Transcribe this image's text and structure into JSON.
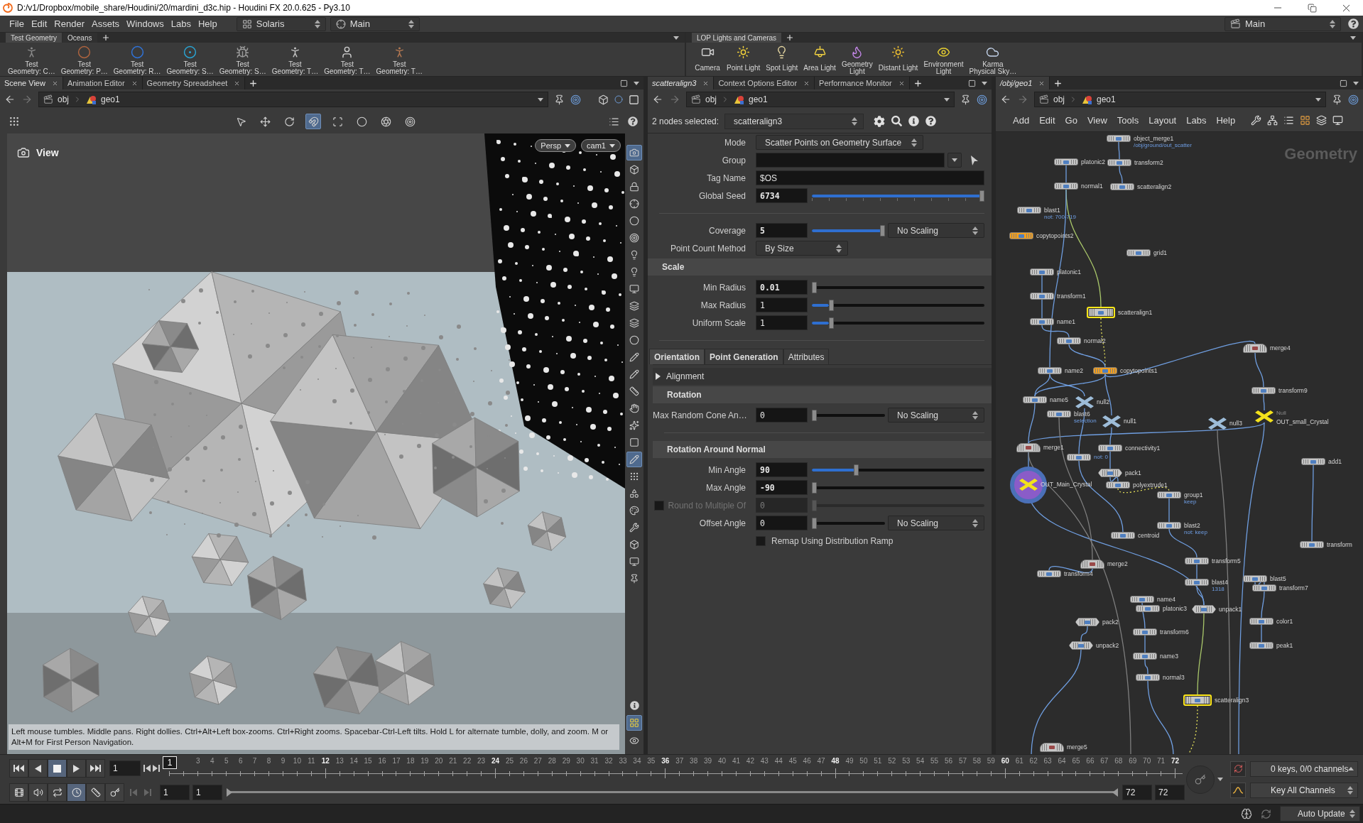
{
  "window": {
    "title": "D:/v1/Dropbox/mobile_share/Houdini/20/mardini_d3c.hip - Houdini FX 20.0.625 - Py3.10"
  },
  "menu_bar": {
    "items": [
      "File",
      "Edit",
      "Render",
      "Assets",
      "Windows",
      "Labs",
      "Help"
    ],
    "desktop": "Solaris",
    "context": "Main",
    "right_context": "Main"
  },
  "shelves": [
    {
      "tabs": [
        {
          "label": "Test Geometry",
          "selected": true
        },
        {
          "label": "Oceans",
          "selected": false
        }
      ],
      "tools": [
        "Test\nGeometry: C…",
        "Test\nGeometry: P…",
        "Test\nGeometry: R…",
        "Test\nGeometry: S…",
        "Test\nGeometry: S…",
        "Test\nGeometry: T…",
        "Test\nGeometry: T…",
        "Test\nGeometry: T…"
      ]
    },
    {
      "tabs": [
        {
          "label": "LOP Lights and Cameras",
          "selected": true
        }
      ],
      "tools": [
        "Camera",
        "Point Light",
        "Spot Light",
        "Area Light",
        "Geometry\nLight",
        "Distant Light",
        "Environment\nLight",
        "Karma\nPhysical Sky…"
      ]
    }
  ],
  "scene_view": {
    "tabs": [
      {
        "label": "Scene View",
        "selected": true
      },
      {
        "label": "Animation Editor",
        "selected": false
      },
      {
        "label": "Geometry Spreadsheet",
        "selected": false
      }
    ],
    "path": [
      "obj",
      "geo1"
    ],
    "top_tools": [
      {
        "on": false
      },
      {
        "on": false
      },
      {
        "on": false
      },
      {
        "on": true
      },
      {
        "on": false
      },
      {
        "on": false
      },
      {
        "on": false
      },
      {
        "on": false
      }
    ],
    "side_tools": [
      {
        "on": true
      },
      {
        "on": false
      },
      {
        "on": false
      },
      {
        "on": false
      },
      {
        "on": false
      },
      {
        "on": false
      },
      {
        "on": false
      },
      {
        "on": false
      },
      {
        "on": false
      },
      {
        "on": false
      },
      {
        "on": false
      },
      {
        "on": false
      },
      {
        "on": false
      },
      {
        "on": false
      },
      {
        "on": false
      },
      {
        "on": false
      },
      {
        "on": false
      },
      {
        "on": false
      },
      {
        "on": true
      },
      {
        "on": false
      },
      {
        "on": false
      },
      {
        "on": false
      },
      {
        "on": false
      },
      {
        "on": false
      },
      {
        "on": false
      },
      {
        "on": false
      },
      {
        "on": false
      },
      {
        "on": true
      },
      {
        "on": false
      }
    ],
    "title": "View",
    "camera_menus": [
      "Persp",
      "cam1"
    ],
    "help_text": "Left mouse tumbles. Middle pans. Right dollies. Ctrl+Alt+Left box-zooms. Ctrl+Right zooms. Spacebar-Ctrl-Left tilts. Hold L for alternate tumble, dolly, and zoom. M or Alt+M for First Person Navigation."
  },
  "parameters": {
    "tabs": [
      {
        "label": "scatteralign3",
        "selected": true
      },
      {
        "label": "Context Options Editor",
        "selected": false
      },
      {
        "label": "Performance Monitor",
        "selected": false
      }
    ],
    "path": [
      "obj",
      "geo1"
    ],
    "selection_label": "2 nodes selected:",
    "node_name": "scatteralign3",
    "rows": [
      {
        "kind": "menu",
        "label": "Mode",
        "value": "Scatter Points on Geometry Surface"
      },
      {
        "kind": "group_field",
        "label": "Group"
      },
      {
        "kind": "string",
        "label": "Tag Name",
        "value": "$OS"
      },
      {
        "kind": "ticked_slider",
        "label": "Global Seed",
        "value": "6734",
        "level": 1,
        "modified": true
      },
      {
        "kind": "separator"
      },
      {
        "kind": "slider",
        "label": "Coverage",
        "value": "5",
        "level": 1,
        "modified": true,
        "scaling": "No Scaling"
      },
      {
        "kind": "menu",
        "label": "Point Count Method",
        "value": "By Size"
      },
      {
        "kind": "heading",
        "label": "Scale"
      },
      {
        "kind": "slider",
        "label": "Min Radius",
        "value": "0.01",
        "level": 0,
        "modified": true
      },
      {
        "kind": "slider",
        "label": "Max Radius",
        "value": "1",
        "level": 0.1,
        "modified": false
      },
      {
        "kind": "slider",
        "label": "Uniform Scale",
        "value": "1",
        "level": 0.1,
        "modified": false
      },
      {
        "kind": "separator"
      }
    ],
    "tab_group": {
      "tabs": [
        {
          "label": "Orientation",
          "selected": true,
          "modified": true
        },
        {
          "label": "Point Generation",
          "selected": false,
          "modified": true
        },
        {
          "label": "Attributes",
          "selected": false,
          "modified": false
        }
      ],
      "rows": [
        {
          "kind": "folder",
          "label": "Alignment",
          "expanded": false
        },
        {
          "kind": "heading",
          "label": "Rotation"
        },
        {
          "kind": "slider",
          "label": "Max Random Cone An…",
          "value": "0",
          "level": 0,
          "modified": false,
          "scaling": "No Scaling"
        },
        {
          "kind": "separator"
        },
        {
          "kind": "heading",
          "label": "Rotation Around Normal"
        },
        {
          "kind": "slider",
          "label": "Min Angle",
          "value": "90",
          "level": 0.25,
          "modified": true
        },
        {
          "kind": "slider",
          "label": "Max Angle",
          "value": "-90",
          "level": 0,
          "modified": true
        },
        {
          "kind": "toggle_slider",
          "label": "Round to Multiple Of",
          "value": "0",
          "level": 0,
          "checked": false,
          "disabled": true
        },
        {
          "kind": "slider",
          "label": "Offset Angle",
          "value": "0",
          "level": 0,
          "modified": false,
          "scaling": "No Scaling"
        },
        {
          "kind": "checkbox",
          "label": "Remap Using Distribution Ramp",
          "checked": false
        }
      ]
    }
  },
  "network": {
    "tabs": [
      {
        "label": "/obj/geo1",
        "selected": true
      }
    ],
    "path": [
      "obj",
      "geo1"
    ],
    "menu": [
      "Add",
      "Edit",
      "Go",
      "View",
      "Tools",
      "Layout",
      "Labs",
      "Help"
    ],
    "context_label": "Geometry",
    "nodes": [
      {
        "name": "object_merge1",
        "kind": "sop",
        "color": "#c6c6c6",
        "selected": false,
        "display": false,
        "note": "/obj/ground/out_scatter"
      },
      {
        "name": "platonic2",
        "kind": "sop",
        "color": "#c6c6c6",
        "selected": false,
        "display": false
      },
      {
        "name": "transform2",
        "kind": "sop",
        "color": "#c6c6c6",
        "selected": false,
        "display": false
      },
      {
        "name": "normal1",
        "kind": "sop",
        "color": "#c6c6c6",
        "selected": false,
        "display": false
      },
      {
        "name": "scatteralign2",
        "kind": "sop",
        "color": "#c6c6c6",
        "selected": false,
        "display": false
      },
      {
        "name": "blast1",
        "kind": "sop",
        "color": "#c6c6c6",
        "selected": false,
        "display": false,
        "note": "not: 700-719"
      },
      {
        "name": "copytopoints2",
        "kind": "sop",
        "color": "#f5a01c",
        "selected": false,
        "display": false
      },
      {
        "name": "grid1",
        "kind": "sop",
        "color": "#c6c6c6",
        "selected": false,
        "display": false
      },
      {
        "name": "platonic1",
        "kind": "sop",
        "color": "#c6c6c6",
        "selected": false,
        "display": false
      },
      {
        "name": "transform1",
        "kind": "sop",
        "color": "#c6c6c6",
        "selected": false,
        "display": false
      },
      {
        "name": "name1",
        "kind": "sop",
        "color": "#c6c6c6",
        "selected": false,
        "display": false
      },
      {
        "name": "scatteralign1",
        "kind": "sop",
        "color": "#c6c6c6",
        "selected": true,
        "display": false
      },
      {
        "name": "normal2",
        "kind": "sop",
        "color": "#c6c6c6",
        "selected": false,
        "display": false
      },
      {
        "name": "merge4",
        "kind": "merge",
        "color": "#c6c6c6",
        "selected": false,
        "display": false
      },
      {
        "name": "name2",
        "kind": "sop",
        "color": "#c6c6c6",
        "selected": false,
        "display": false
      },
      {
        "name": "copytopoints1",
        "kind": "sop",
        "color": "#f5a01c",
        "selected": false,
        "display": false
      },
      {
        "name": "transform9",
        "kind": "sop",
        "color": "#c6c6c6",
        "selected": false,
        "display": false
      },
      {
        "name": "name5",
        "kind": "sop",
        "color": "#c6c6c6",
        "selected": false,
        "display": false
      },
      {
        "name": "null2",
        "kind": "null",
        "color": "#9dbcd8",
        "selected": false,
        "display": false
      },
      {
        "name": "blast6",
        "kind": "sop",
        "color": "#c6c6c6",
        "selected": false,
        "display": false,
        "note": "selection"
      },
      {
        "name": "null1",
        "kind": "null",
        "color": "#9dbcd8",
        "selected": false,
        "display": false
      },
      {
        "name": "null3",
        "kind": "null",
        "color": "#9dbcd8",
        "selected": false,
        "display": false
      },
      {
        "name": "OUT_small_Crystal",
        "kind": "null",
        "color": "#f3e21b",
        "selected": false,
        "display": false,
        "type_label": "Null"
      },
      {
        "name": "merge1",
        "kind": "merge",
        "color": "#c6c6c6",
        "selected": false,
        "display": false
      },
      {
        "kind": "sop",
        "color": "#c6c6c6",
        "selected": false,
        "display": false,
        "note": "not: 0"
      },
      {
        "name": "connectivity1",
        "kind": "sop",
        "color": "#c6c6c6",
        "selected": false,
        "display": false
      },
      {
        "name": "add1",
        "kind": "sop",
        "color": "#c6c6c6",
        "selected": false,
        "display": false
      },
      {
        "name": "OUT_Main_Crystal",
        "kind": "null",
        "color": "#f3e21b",
        "selected": false,
        "display": true
      },
      {
        "name": "pack1",
        "kind": "pack",
        "color": "#c6c6c6",
        "selected": false,
        "display": false
      },
      {
        "name": "polyextrude1",
        "kind": "sop",
        "color": "#c6c6c6",
        "selected": false,
        "display": false
      },
      {
        "name": "group1",
        "kind": "sop",
        "color": "#c6c6c6",
        "selected": false,
        "display": false,
        "note": "keep"
      },
      {
        "name": "centroid",
        "kind": "sop",
        "color": "#c6c6c6",
        "selected": false,
        "display": false
      },
      {
        "name": "blast2",
        "kind": "sop",
        "color": "#c6c6c6",
        "selected": false,
        "display": false,
        "note": "not: keep"
      },
      {
        "name": "transform",
        "kind": "sop",
        "color": "#c6c6c6",
        "selected": false,
        "display": false
      },
      {
        "name": "merge2",
        "kind": "merge",
        "color": "#c6c6c6",
        "selected": false,
        "display": false
      },
      {
        "name": "transform5",
        "kind": "sop",
        "color": "#c6c6c6",
        "selected": false,
        "display": false
      },
      {
        "name": "transform4",
        "kind": "sop",
        "color": "#c6c6c6",
        "selected": false,
        "display": false
      },
      {
        "name": "blast4",
        "kind": "sop",
        "color": "#c6c6c6",
        "selected": false,
        "display": false,
        "note": "1318"
      },
      {
        "name": "blast5",
        "kind": "sop",
        "color": "#c6c6c6",
        "selected": false,
        "display": false
      },
      {
        "name": "transform7",
        "kind": "sop",
        "color": "#c6c6c6",
        "selected": false,
        "display": false
      },
      {
        "name": "name4",
        "kind": "sop",
        "color": "#c6c6c6",
        "selected": false,
        "display": false
      },
      {
        "name": "platonic3",
        "kind": "sop",
        "color": "#c6c6c6",
        "selected": false,
        "display": false
      },
      {
        "name": "unpack1",
        "kind": "pack",
        "color": "#c6c6c6",
        "selected": false,
        "display": false
      },
      {
        "name": "pack2",
        "kind": "pack",
        "color": "#c6c6c6",
        "selected": false,
        "display": false
      },
      {
        "name": "color1",
        "kind": "sop",
        "color": "#c6c6c6",
        "selected": false,
        "display": false
      },
      {
        "name": "transform6",
        "kind": "sop",
        "color": "#c6c6c6",
        "selected": false,
        "display": false
      },
      {
        "name": "unpack2",
        "kind": "pack",
        "color": "#c6c6c6",
        "selected": false,
        "display": false
      },
      {
        "name": "peak1",
        "kind": "sop",
        "color": "#c6c6c6",
        "selected": false,
        "display": false
      },
      {
        "name": "name3",
        "kind": "sop",
        "color": "#c6c6c6",
        "selected": false,
        "display": false
      },
      {
        "name": "normal3",
        "kind": "sop",
        "color": "#c6c6c6",
        "selected": false,
        "display": false
      },
      {
        "name": "scatteralign3",
        "kind": "sop",
        "color": "#c6c6c6",
        "selected": true,
        "display": false
      },
      {
        "name": "merge5",
        "kind": "merge",
        "color": "#c6c6c6",
        "selected": false,
        "display": false
      }
    ]
  },
  "timeline": {
    "playback": [
      {
        "kind": "first",
        "selected": false
      },
      {
        "kind": "reverse",
        "selected": false
      },
      {
        "kind": "stop",
        "selected": true
      },
      {
        "kind": "play",
        "selected": false
      },
      {
        "kind": "last",
        "selected": false
      }
    ],
    "frame": "1",
    "current_frame": "1",
    "frame_labels": [
      "3",
      "4",
      "5",
      "6",
      "7",
      "8",
      "9",
      "10",
      "11",
      "12",
      "13",
      "14",
      "15",
      "16",
      "17",
      "18",
      "19",
      "20",
      "21",
      "22",
      "23",
      "24",
      "25",
      "26",
      "27",
      "28",
      "29",
      "30",
      "31",
      "32",
      "33",
      "34",
      "35",
      "36",
      "37",
      "38",
      "39",
      "40",
      "41",
      "42",
      "43",
      "44",
      "45",
      "46",
      "47",
      "48",
      "49",
      "50",
      "51",
      "52",
      "53",
      "54",
      "55",
      "56",
      "57",
      "58",
      "59",
      "60",
      "61",
      "62",
      "63",
      "64",
      "65",
      "66",
      "67",
      "68",
      "69",
      "70",
      "71",
      "72"
    ],
    "options": [
      {
        "kind": "frame_view",
        "on": false
      },
      {
        "kind": "audio",
        "on": false
      },
      {
        "kind": "loop",
        "on": false
      },
      {
        "kind": "realtime",
        "on": true
      },
      {
        "kind": "ticks",
        "on": false
      },
      {
        "kind": "keys",
        "on": false
      }
    ],
    "range": {
      "fields": [
        "1",
        "1",
        "72",
        "72"
      ],
      "level": 1
    },
    "keys_status": "0 keys, 0/0 channels",
    "key_mode": "Key All Channels"
  },
  "status_bar": {
    "update_mode": "Auto Update"
  }
}
